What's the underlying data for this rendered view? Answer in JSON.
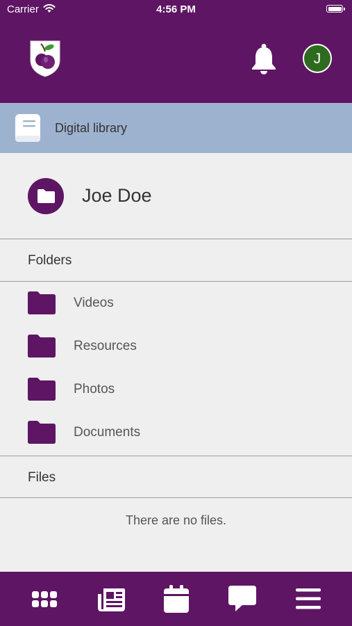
{
  "status_bar": {
    "carrier": "Carrier",
    "time": "4:56 PM"
  },
  "header": {
    "avatar_initial": "J",
    "logo_icon": "plum-shield-logo",
    "notification_icon": "bell-icon"
  },
  "library_bar": {
    "label": "Digital library",
    "icon": "book-icon"
  },
  "owner": {
    "name": "Joe Doe",
    "icon": "folder-icon"
  },
  "folders_section": {
    "title": "Folders",
    "items": [
      {
        "label": "Videos"
      },
      {
        "label": "Resources"
      },
      {
        "label": "Photos"
      },
      {
        "label": "Documents"
      }
    ]
  },
  "files_section": {
    "title": "Files",
    "empty_text": "There are no files."
  },
  "tab_bar": {
    "items": [
      {
        "icon": "apps-grid-icon"
      },
      {
        "icon": "news-icon"
      },
      {
        "icon": "calendar-icon"
      },
      {
        "icon": "chat-icon"
      },
      {
        "icon": "menu-icon"
      }
    ]
  },
  "colors": {
    "brand": "#5e1563",
    "library_bar": "#9db2cf",
    "background": "#efefef",
    "avatar": "#2f6b1f"
  }
}
